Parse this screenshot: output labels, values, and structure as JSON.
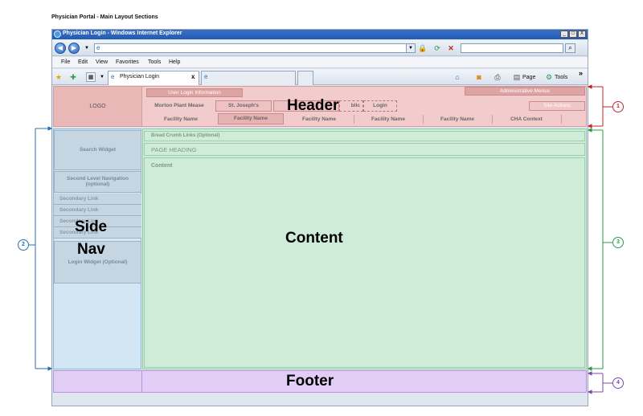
{
  "document_title": "Physician Portal - Main Layout Sections",
  "browser": {
    "window_title": "Physician Login - Windows Internet Explorer",
    "menu": [
      "File",
      "Edit",
      "View",
      "Favorites",
      "Tools",
      "Help"
    ],
    "tab_title": "Physician Login",
    "tab_close": "x",
    "cmd_page": "Page",
    "cmd_tools": "Tools",
    "chevron": "»",
    "win_min": "_",
    "win_max": "□",
    "win_close": "X"
  },
  "header": {
    "logo": "LOGO",
    "user_login_info": "User Login Information",
    "admin_menus": "Administrative Menus",
    "site_actions": "Site Actions",
    "tabs": [
      "Morton Plant Mease",
      "St. Joseph's",
      "blic",
      "Login"
    ],
    "facilities": [
      "Facility Name",
      "Facility Name",
      "Facility Name",
      "Facility Name",
      "Facility Name",
      "CHA Context"
    ],
    "label": "Header"
  },
  "sidenav": {
    "search_widget": "Search Widget",
    "second_level_nav": "Second Level Navigation (optional)",
    "links": [
      "Secondary Link",
      "Secondary Link",
      "Secondary Link",
      "Secondary Link"
    ],
    "login_widget": "Login Widget (Optional)",
    "label_line1": "Side",
    "label_line2": "Nav"
  },
  "content": {
    "breadcrumb": "Bread Crumb Links (Optional)",
    "page_heading": "PAGE HEADING",
    "content_label": "Content",
    "label": "Content"
  },
  "footer": {
    "label": "Footer"
  },
  "callouts": [
    "1",
    "2",
    "3",
    "4"
  ],
  "colors": {
    "header": "#f2cccc",
    "sidenav": "#d2e6f4",
    "content": "#cfecd8",
    "footer": "#e2cdf6"
  }
}
